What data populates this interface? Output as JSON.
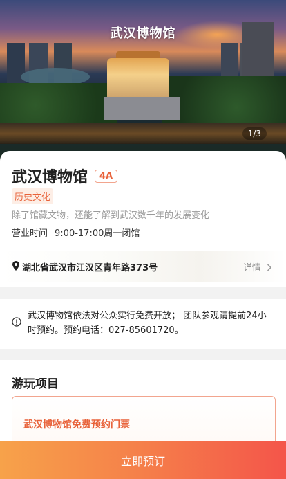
{
  "hero": {
    "title": "武汉博物馆",
    "counter": "1/3"
  },
  "info": {
    "name": "武汉博物馆",
    "level_badge": "4A",
    "category_tag": "历史文化",
    "description": "除了馆藏文物，还能了解到武汉数千年的发展变化",
    "hours_label": "营业时间",
    "hours_value": "9:00-17:00周一闭馆",
    "address": "湖北省武汉市江汉区青年路373号",
    "detail_label": "详情"
  },
  "notice": {
    "text": "武汉博物馆依法对公众实行免费开放；  团队参观请提前24小时预约。预约电话：027-85601720。"
  },
  "projects": {
    "heading": "游玩项目",
    "ticket_name": "武汉博物馆免费预约门票"
  },
  "footer": {
    "book_label": "立即预订"
  },
  "colors": {
    "accent": "#e8623a",
    "button_start": "#f7a24a",
    "button_end": "#f4554a"
  },
  "icons": {
    "location": "location-pin-icon",
    "detail_arrow": "chevron-right-icon",
    "notice": "info-circle-icon"
  }
}
